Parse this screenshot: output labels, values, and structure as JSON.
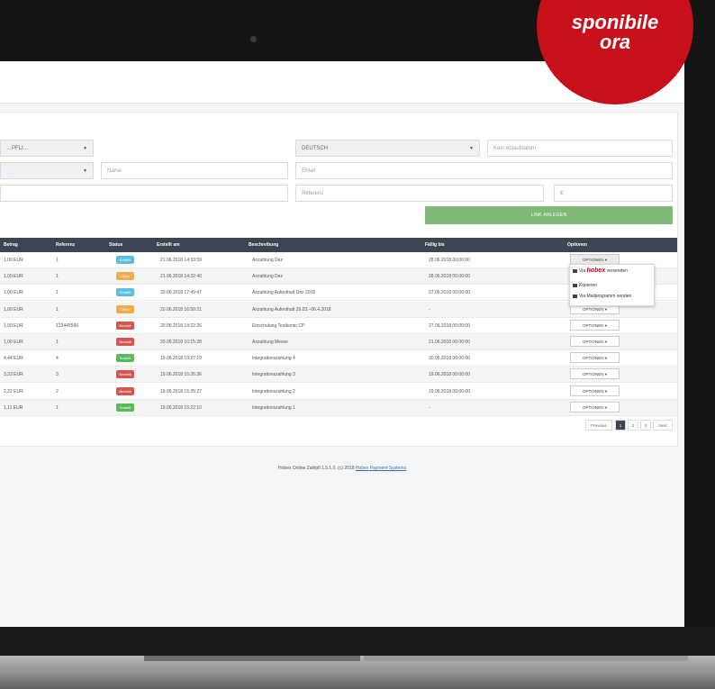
{
  "promo": {
    "line1": "sponibile",
    "line2": "ora"
  },
  "form": {
    "select_left": "…PFLI…",
    "select_language": "DEUTSCH",
    "date_placeholder": "Kein Ablaufdatum",
    "name_placeholder": "Name",
    "email_placeholder": "EMail",
    "referenz_placeholder": "Referenz",
    "currency_placeholder": "€",
    "link_button": "LINK ANLEGEN"
  },
  "table": {
    "headers": [
      "Betrag",
      "Referenz",
      "Status",
      "Erstellt am",
      "Beschreibung",
      "Fällig bis",
      "Optionen"
    ],
    "rows": [
      {
        "betrag": "1,00 EUR",
        "referenz": "1",
        "status": "Erstellt",
        "status_color": "#5bc0de",
        "erstellt": "21.06.2018 14:33:59",
        "beschreibung": "Anzahlung Dez",
        "faellig": "28.06.2018 00:00:00"
      },
      {
        "betrag": "1,00 EUR",
        "referenz": "1",
        "status": "Offen",
        "status_color": "#f0ad4e",
        "erstellt": "21.06.2018 14:32:40",
        "beschreibung": "Anzahlung Dez",
        "faellig": "28.06.2018 00:00:00"
      },
      {
        "betrag": "1,00 EUR",
        "referenz": "1",
        "status": "Erstellt",
        "status_color": "#5bc0de",
        "erstellt": "20.06.2018 17:49:47",
        "beschreibung": "Anzahlung Aufenthalt Dez 2018",
        "faellig": "27.06.2018 00:00:00"
      },
      {
        "betrag": "1,00 EUR",
        "referenz": "1",
        "status": "Offen",
        "status_color": "#f0ad4e",
        "erstellt": "20.06.2018 16:59:21",
        "beschreibung": "Anzahlung Aufenthalt 29.03.–06.4.2018",
        "faellig": "-"
      },
      {
        "betrag": "1,00 EUR",
        "referenz": "123445566",
        "status": "Bezahlt",
        "status_color": "#d9534f",
        "erstellt": "20.06.2018 14:22:26",
        "beschreibung": "Einschulung Testkonto CP",
        "faellig": "27.06.2018 00:00:00"
      },
      {
        "betrag": "1,00 EUR",
        "referenz": "1",
        "status": "Bezahlt",
        "status_color": "#d9534f",
        "erstellt": "20.06.2018 10:15:28",
        "beschreibung": "Anzahlung Messe",
        "faellig": "21.06.2018 00:00:00"
      },
      {
        "betrag": "4,44 EUR",
        "referenz": "4",
        "status": "Erstellt",
        "status_color": "#5cb85c",
        "erstellt": "19.06.2018 15:27:19",
        "beschreibung": "Integrationszahlung 4",
        "faellig": "20.06.2018 00:00:00"
      },
      {
        "betrag": "3,33 EUR",
        "referenz": "3",
        "status": "Bezahlt",
        "status_color": "#d9534f",
        "erstellt": "19.06.2018 15:26:36",
        "beschreibung": "Integrationszahlung 3",
        "faellig": "19.06.2018 00:00:00"
      },
      {
        "betrag": "2,22 EUR",
        "referenz": "2",
        "status": "Bezahlt",
        "status_color": "#d9534f",
        "erstellt": "19.06.2018 15:25:27",
        "beschreibung": "Integrationszahlung 2",
        "faellig": "19.06.2018 00:00:00"
      },
      {
        "betrag": "1,11 EUR",
        "referenz": "1",
        "status": "Erstellt",
        "status_color": "#5cb85c",
        "erstellt": "19.06.2018 15:22:10",
        "beschreibung": "Integrationszahlung 1",
        "faellig": "-"
      }
    ],
    "options_button": "OPTIONEN ▾"
  },
  "dropdown": {
    "item1_prefix": "Via",
    "item1_brand": "hobex",
    "item1_suffix": "versenden",
    "item2": "Kopieren",
    "item3": "Via Mailprogramm senden"
  },
  "pagination": {
    "previous": "Previous",
    "pages": [
      "1",
      "2",
      "3"
    ],
    "next": "Next"
  },
  "footer": {
    "text": "Hobex Online Zahlpfl 1.5.1.0. (c) 2018 ",
    "link": "Hobex Payment Systems"
  }
}
